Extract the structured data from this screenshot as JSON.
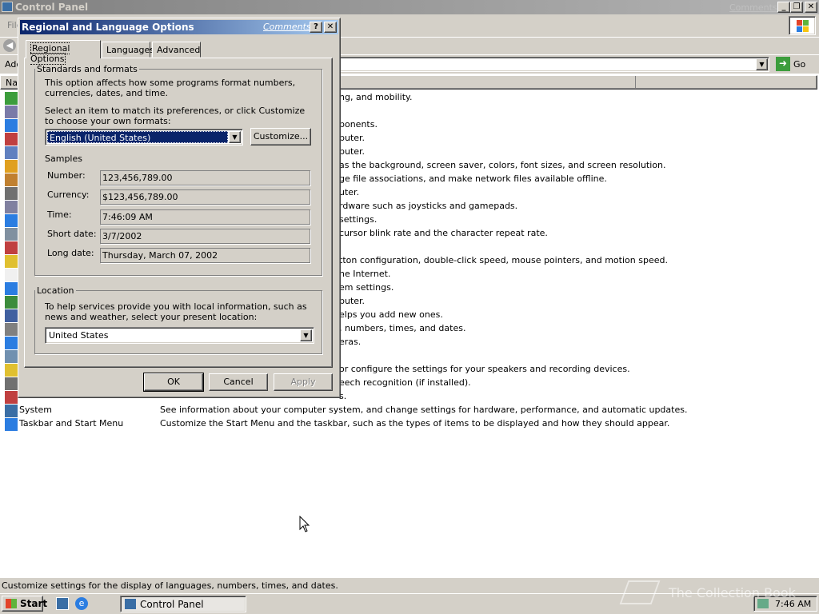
{
  "window": {
    "title": "Control Panel",
    "comments_link": "Comments?",
    "menu_first": "File",
    "address_label": "Address",
    "go_label": "Go",
    "list_header_name": "Name",
    "status_text": "Customize settings for the display of languages, numbers, times, and dates."
  },
  "rows": [
    {
      "desc": "ng, and mobility.",
      "cut": true
    },
    {
      "desc": "",
      "cut": true
    },
    {
      "desc": "ponents.",
      "cut": true
    },
    {
      "desc": "puter.",
      "cut": true
    },
    {
      "desc": "puter.",
      "cut": true
    },
    {
      "desc": "as the background, screen saver, colors, font sizes, and screen resolution.",
      "cut": true
    },
    {
      "desc": "ge file associations, and make network files available offline.",
      "cut": true
    },
    {
      "desc": "uter.",
      "cut": true
    },
    {
      "desc": "rdware such as joysticks and gamepads.",
      "cut": true
    },
    {
      "desc": "settings.",
      "cut": true
    },
    {
      "desc": "cursor blink rate and the character repeat rate.",
      "cut": true
    },
    {
      "desc": "",
      "cut": true
    },
    {
      "desc": "tton configuration, double-click speed, mouse pointers, and motion speed.",
      "cut": true
    },
    {
      "desc": "ne Internet.",
      "cut": true
    },
    {
      "desc": "em settings.",
      "cut": true
    },
    {
      "desc": "puter.",
      "cut": true
    },
    {
      "desc": "elps you add new ones.",
      "cut": true
    },
    {
      "desc": ", numbers, times, and dates.",
      "cut": true
    },
    {
      "desc": "eras.",
      "cut": true
    },
    {
      "desc": "",
      "cut": true
    },
    {
      "desc": "or configure the settings for your speakers and recording devices.",
      "cut": true
    },
    {
      "desc": "eech recognition (if installed).",
      "cut": true
    },
    {
      "desc": "s.",
      "cut": true
    },
    {
      "name": "System",
      "desc": "See information about your computer system, and change settings for hardware, performance, and automatic updates.",
      "cut": false
    },
    {
      "name": "Taskbar and Start Menu",
      "desc": "Customize the Start Menu and the taskbar, such as the types of items to be displayed and how they should appear.",
      "cut": false
    }
  ],
  "dialog": {
    "title": "Regional and Language Options",
    "comments_link": "Comments?",
    "tabs": [
      "Regional Options",
      "Languages",
      "Advanced"
    ],
    "standards": {
      "legend": "Standards and formats",
      "intro": "This option affects how some programs format numbers, currencies, dates, and time.",
      "select_prompt": "Select an item to match its preferences, or click Customize to choose your own formats:",
      "selected_locale": "English (United States)",
      "customize_label": "Customize..."
    },
    "samples": {
      "heading": "Samples",
      "number_label": "Number:",
      "number_value": "123,456,789.00",
      "currency_label": "Currency:",
      "currency_value": "$123,456,789.00",
      "time_label": "Time:",
      "time_value": "7:46:09 AM",
      "short_date_label": "Short date:",
      "short_date_value": "3/7/2002",
      "long_date_label": "Long date:",
      "long_date_value": "Thursday, March 07, 2002"
    },
    "location": {
      "legend": "Location",
      "text": "To help services provide you with local information, such as news and weather, select your present location:",
      "selected": "United States"
    },
    "buttons": {
      "ok": "OK",
      "cancel": "Cancel",
      "apply": "Apply"
    }
  },
  "taskbar": {
    "start_label": "Start",
    "task_label": "Control Panel",
    "clock": "7:46 AM"
  },
  "watermark": "The Collection Book"
}
